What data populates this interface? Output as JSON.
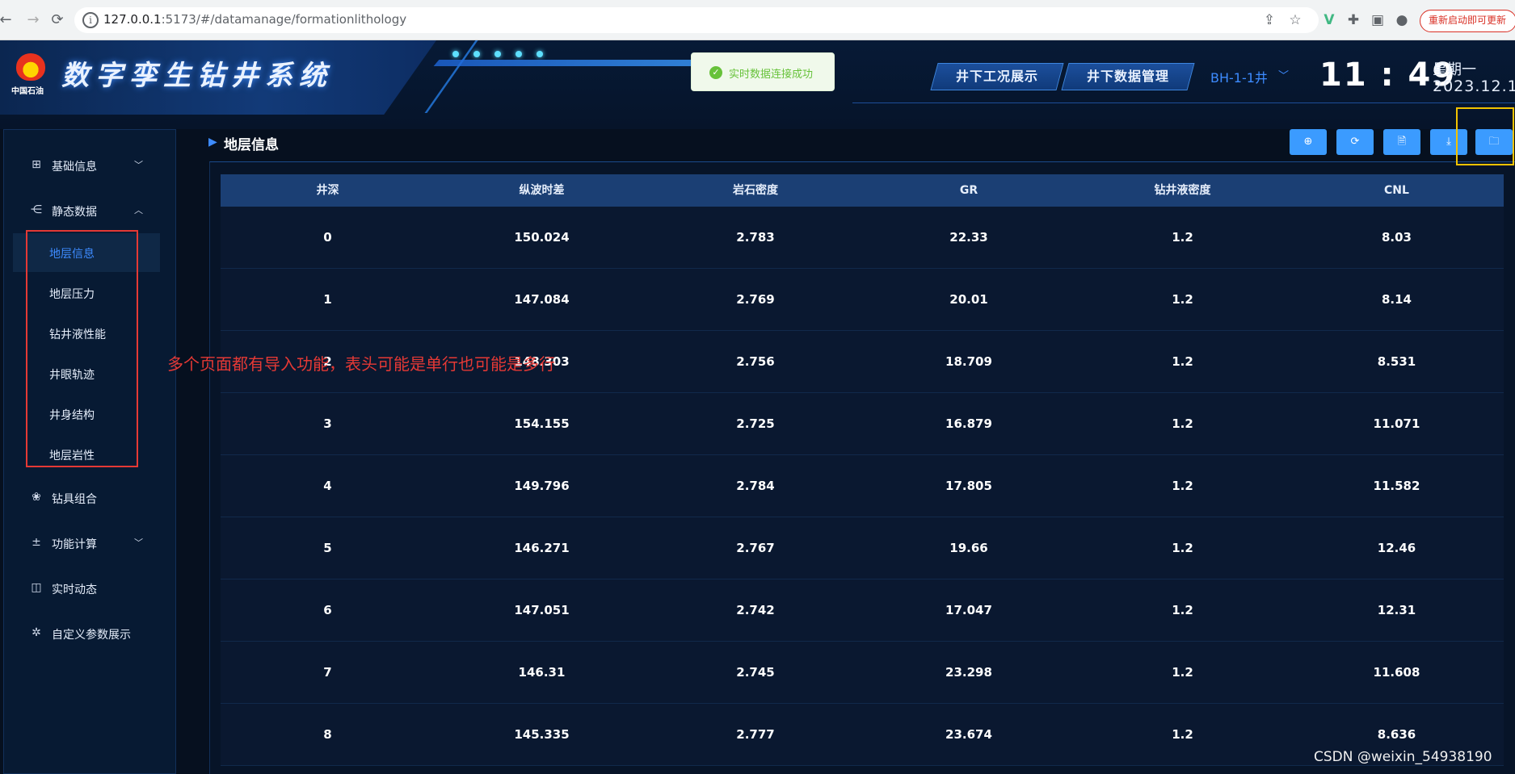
{
  "browser": {
    "url_host": "127.0.0.1",
    "url_rest": ":5173/#/datamanage/formationlithology",
    "update_button": "重新启动即可更新"
  },
  "header": {
    "logo_text": "中国石油",
    "app_title": "数字孪生钻井系统",
    "toast": "实时数据连接成功",
    "nav_buttons": [
      "井下工况展示",
      "井下数据管理"
    ],
    "well": "BH-1-1井",
    "time": "11 : 49",
    "weekday": "星期一",
    "date": "2023.12.1"
  },
  "sidebar": {
    "items": [
      {
        "label": "基础信息",
        "icon": "grid-icon"
      },
      {
        "label": "静态数据",
        "icon": "share-icon"
      },
      {
        "label": "钻具组合",
        "icon": "circles-icon"
      },
      {
        "label": "功能计算",
        "icon": "calculator-icon"
      },
      {
        "label": "实时动态",
        "icon": "robot-icon"
      },
      {
        "label": "自定义参数展示",
        "icon": "custom-icon"
      }
    ],
    "submenu": [
      "地层信息",
      "地层压力",
      "钻井液性能",
      "井眼轨迹",
      "井身结构",
      "地层岩性"
    ],
    "active_submenu": "地层信息"
  },
  "annotation": "多个页面都有导入功能，表头可能是单行也可能是多行",
  "main": {
    "title": "地层信息",
    "toolbar": [
      {
        "name": "add-icon",
        "glyph": "⊕"
      },
      {
        "name": "refresh-icon",
        "glyph": "⟳"
      },
      {
        "name": "file-icon",
        "glyph": "🗎"
      },
      {
        "name": "download-icon",
        "glyph": "⤓"
      },
      {
        "name": "folder-icon",
        "glyph": "🗀"
      }
    ]
  },
  "table": {
    "headers": [
      "井深",
      "纵波时差",
      "岩石密度",
      "GR",
      "钻井液密度",
      "CNL"
    ],
    "rows": [
      [
        "0",
        "150.024",
        "2.783",
        "22.33",
        "1.2",
        "8.03"
      ],
      [
        "1",
        "147.084",
        "2.769",
        "20.01",
        "1.2",
        "8.14"
      ],
      [
        "2",
        "148.303",
        "2.756",
        "18.709",
        "1.2",
        "8.531"
      ],
      [
        "3",
        "154.155",
        "2.725",
        "16.879",
        "1.2",
        "11.071"
      ],
      [
        "4",
        "149.796",
        "2.784",
        "17.805",
        "1.2",
        "11.582"
      ],
      [
        "5",
        "146.271",
        "2.767",
        "19.66",
        "1.2",
        "12.46"
      ],
      [
        "6",
        "147.051",
        "2.742",
        "17.047",
        "1.2",
        "12.31"
      ],
      [
        "7",
        "146.31",
        "2.745",
        "23.298",
        "1.2",
        "11.608"
      ],
      [
        "8",
        "145.335",
        "2.777",
        "23.674",
        "1.2",
        "8.636"
      ]
    ]
  },
  "watermark": "CSDN @weixin_54938190"
}
